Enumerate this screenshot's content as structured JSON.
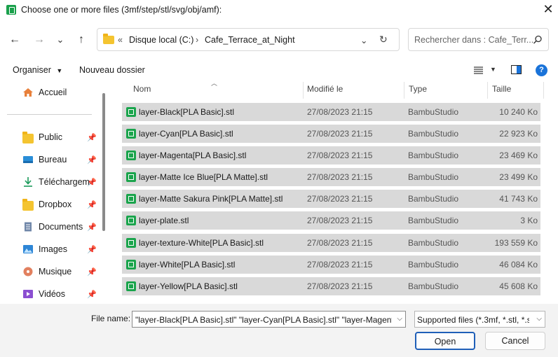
{
  "window": {
    "title": "Choose one or more files (3mf/step/stl/svg/obj/amf):",
    "close_glyph": "✕"
  },
  "nav": {
    "back": "←",
    "forward": "→",
    "recent": "⌄",
    "up": "↑",
    "refresh": "↻"
  },
  "address": {
    "chevron": "«",
    "segments": [
      "Disque local (C:)",
      "Cafe_Terrace_at_Night"
    ],
    "separator": "›",
    "dropdown": "⌄"
  },
  "search": {
    "placeholder": "Rechercher dans : Cafe_Terr...",
    "icon": "search-icon"
  },
  "toolbar": {
    "organize": "Organiser",
    "new_folder": "Nouveau dossier"
  },
  "sidebar": {
    "items": [
      {
        "label": "Accueil",
        "icon": "home-icon",
        "pinned": false
      },
      {
        "label": "Public",
        "icon": "folder-icon",
        "pinned": true
      },
      {
        "label": "Bureau",
        "icon": "desktop-icon",
        "pinned": true
      },
      {
        "label": "Téléchargem",
        "icon": "download-icon",
        "pinned": true
      },
      {
        "label": "Dropbox",
        "icon": "folder-icon",
        "pinned": true
      },
      {
        "label": "Documents",
        "icon": "documents-icon",
        "pinned": true
      },
      {
        "label": "Images",
        "icon": "images-icon",
        "pinned": true
      },
      {
        "label": "Musique",
        "icon": "music-icon",
        "pinned": true
      },
      {
        "label": "Vidéos",
        "icon": "videos-icon",
        "pinned": true
      }
    ]
  },
  "columns": {
    "name": "Nom",
    "modified": "Modifié le",
    "type": "Type",
    "size": "Taille"
  },
  "files": [
    {
      "name": "layer-Black[PLA Basic].stl",
      "date": "27/08/2023 21:15",
      "type": "BambuStudio",
      "size": "10 240 Ko"
    },
    {
      "name": "layer-Cyan[PLA Basic].stl",
      "date": "27/08/2023 21:15",
      "type": "BambuStudio",
      "size": "22 923 Ko"
    },
    {
      "name": "layer-Magenta[PLA Basic].stl",
      "date": "27/08/2023 21:15",
      "type": "BambuStudio",
      "size": "23 469 Ko"
    },
    {
      "name": "layer-Matte Ice Blue[PLA Matte].stl",
      "date": "27/08/2023 21:15",
      "type": "BambuStudio",
      "size": "23 499 Ko"
    },
    {
      "name": "layer-Matte Sakura Pink[PLA Matte].stl",
      "date": "27/08/2023 21:15",
      "type": "BambuStudio",
      "size": "41 743 Ko"
    },
    {
      "name": "layer-plate.stl",
      "date": "27/08/2023 21:15",
      "type": "BambuStudio",
      "size": "3 Ko"
    },
    {
      "name": "layer-texture-White[PLA Basic].stl",
      "date": "27/08/2023 21:15",
      "type": "BambuStudio",
      "size": "193 559 Ko"
    },
    {
      "name": "layer-White[PLA Basic].stl",
      "date": "27/08/2023 21:15",
      "type": "BambuStudio",
      "size": "46 084 Ko"
    },
    {
      "name": "layer-Yellow[PLA Basic].stl",
      "date": "27/08/2023 21:15",
      "type": "BambuStudio",
      "size": "45 608 Ko"
    }
  ],
  "footer": {
    "file_name_label": "File name:",
    "file_name_value": "\"layer-Black[PLA Basic].stl\" \"layer-Cyan[PLA Basic].stl\" \"layer-Magent",
    "file_type_value": "Supported files (*.3mf, *.stl, *.st",
    "open": "Open",
    "cancel": "Cancel"
  },
  "colors": {
    "accent": "#1a73d9",
    "selection": "#d9d9d9",
    "file_icon": "#1aa44c"
  }
}
